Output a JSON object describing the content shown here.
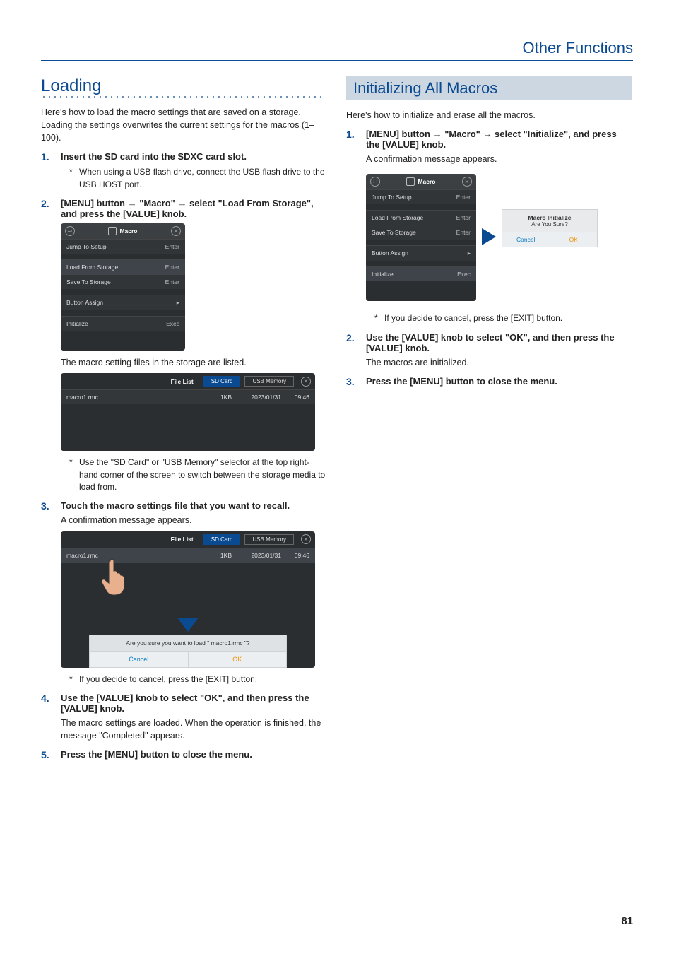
{
  "page": {
    "top_right_heading": "Other Functions",
    "page_number": "81"
  },
  "left": {
    "heading": "Loading",
    "intro": "Here's how to load the macro settings that are saved on a storage. Loading the settings overwrites the current settings for the macros (1–100).",
    "steps": [
      {
        "title": "Insert the SD card into the SDXC card slot.",
        "notes": [
          "When using a USB flash drive, connect the USB flash drive to the USB HOST port."
        ]
      },
      {
        "title_parts": [
          "[MENU] button ",
          " \"Macro\" ",
          " select \"Load From Storage\", and press the [VALUE] knob."
        ],
        "after_text": "The macro setting files in the storage are listed.",
        "after_notes": [
          "Use the \"SD Card\" or \"USB Memory\" selector at the top right-hand corner of the screen to switch between the storage media to load from."
        ]
      },
      {
        "title": "Touch the macro settings file that you want to recall.",
        "body": "A confirmation message appears.",
        "after_notes": [
          "If you decide to cancel, press the [EXIT] button."
        ]
      },
      {
        "title": "Use the [VALUE] knob to select \"OK\", and then press the [VALUE] knob.",
        "body": "The macro settings are loaded. When the operation is finished, the message \"Completed\" appears."
      },
      {
        "title": "Press the [MENU] button to close the menu."
      }
    ]
  },
  "right": {
    "heading": "Initializing All Macros",
    "intro": "Here's how to initialize and erase all the macros.",
    "steps": [
      {
        "title_parts": [
          "[MENU] button ",
          " \"Macro\" ",
          " select \"Initialize\", and press the [VALUE] knob."
        ],
        "body": "A confirmation message appears.",
        "after_notes": [
          "If you decide to cancel, press the [EXIT] button."
        ]
      },
      {
        "title": "Use the [VALUE] knob to select \"OK\", and then press the [VALUE] knob.",
        "body": "The macros are initialized."
      },
      {
        "title": "Press the [MENU] button to close the menu."
      }
    ]
  },
  "menu": {
    "title": "Macro",
    "rows": [
      {
        "label": "Jump To Setup",
        "value": "Enter"
      },
      {
        "label": "Load From Storage",
        "value": "Enter"
      },
      {
        "label": "Save To Storage",
        "value": "Enter"
      },
      {
        "label": "Button Assign",
        "value": "▸"
      },
      {
        "label": "Initialize",
        "value": "Exec"
      }
    ]
  },
  "file_list": {
    "title": "File List",
    "tabs": {
      "sd": "SD Card",
      "usb": "USB Memory"
    },
    "row": {
      "name": "macro1.rmc",
      "size": "1KB",
      "date": "2023/01/31",
      "time": "09:46"
    }
  },
  "confirm": {
    "message": "Are you sure you want to load \" macro1.rmc \"?",
    "cancel": "Cancel",
    "ok": "OK"
  },
  "init_dialog": {
    "title": "Macro Initialize",
    "sub": "Are You Sure?",
    "cancel": "Cancel",
    "ok": "OK"
  },
  "arrow": "→"
}
